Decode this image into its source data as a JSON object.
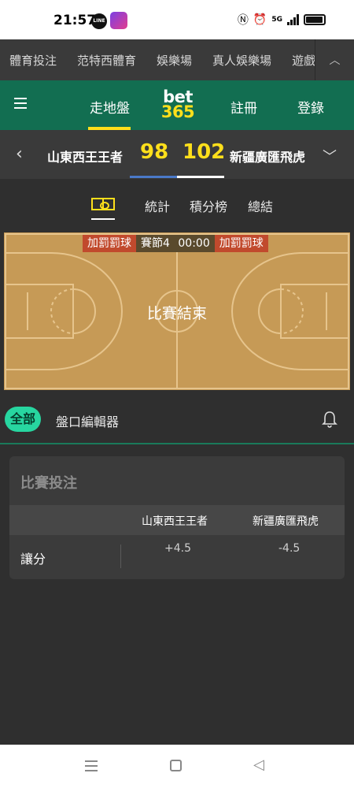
{
  "status_bar": {
    "time": "21:57",
    "line_app": "LINE",
    "network": "5G"
  },
  "top_nav": {
    "items": [
      "體育投注",
      "范特西體育",
      "娛樂場",
      "真人娛樂場",
      "遊戲"
    ]
  },
  "header": {
    "live_label": "走地盤",
    "logo_top": "bet",
    "logo_bottom": "365",
    "register_label": "註冊",
    "login_label": "登錄"
  },
  "scoreboard": {
    "home_team": "山東西王王者",
    "home_score": "98",
    "away_score": "102",
    "away_team": "新疆廣匯飛虎"
  },
  "tabs": {
    "court_icon": "basketball-court-icon",
    "stats": "統計",
    "standings": "積分榜",
    "summary": "總結"
  },
  "court": {
    "bonus_left": "加罰罰球",
    "period": "賽節4",
    "clock": "00:00",
    "bonus_right": "加罰罰球",
    "status": "比賽結束"
  },
  "filters": {
    "all_label": "全部",
    "editor_label": "盤口編輯器",
    "bell_icon": "bell-icon"
  },
  "market": {
    "title": "比賽投注",
    "columns": [
      "山東西王王者",
      "新疆廣匯飛虎"
    ],
    "rows": [
      {
        "label": "讓分",
        "odds": [
          "+4.5",
          "-4.5"
        ]
      }
    ]
  },
  "colors": {
    "brand_green": "#126e51",
    "accent_yellow": "#ffdf1b",
    "active_chip": "#27d6a0",
    "court": "#c69a56"
  }
}
